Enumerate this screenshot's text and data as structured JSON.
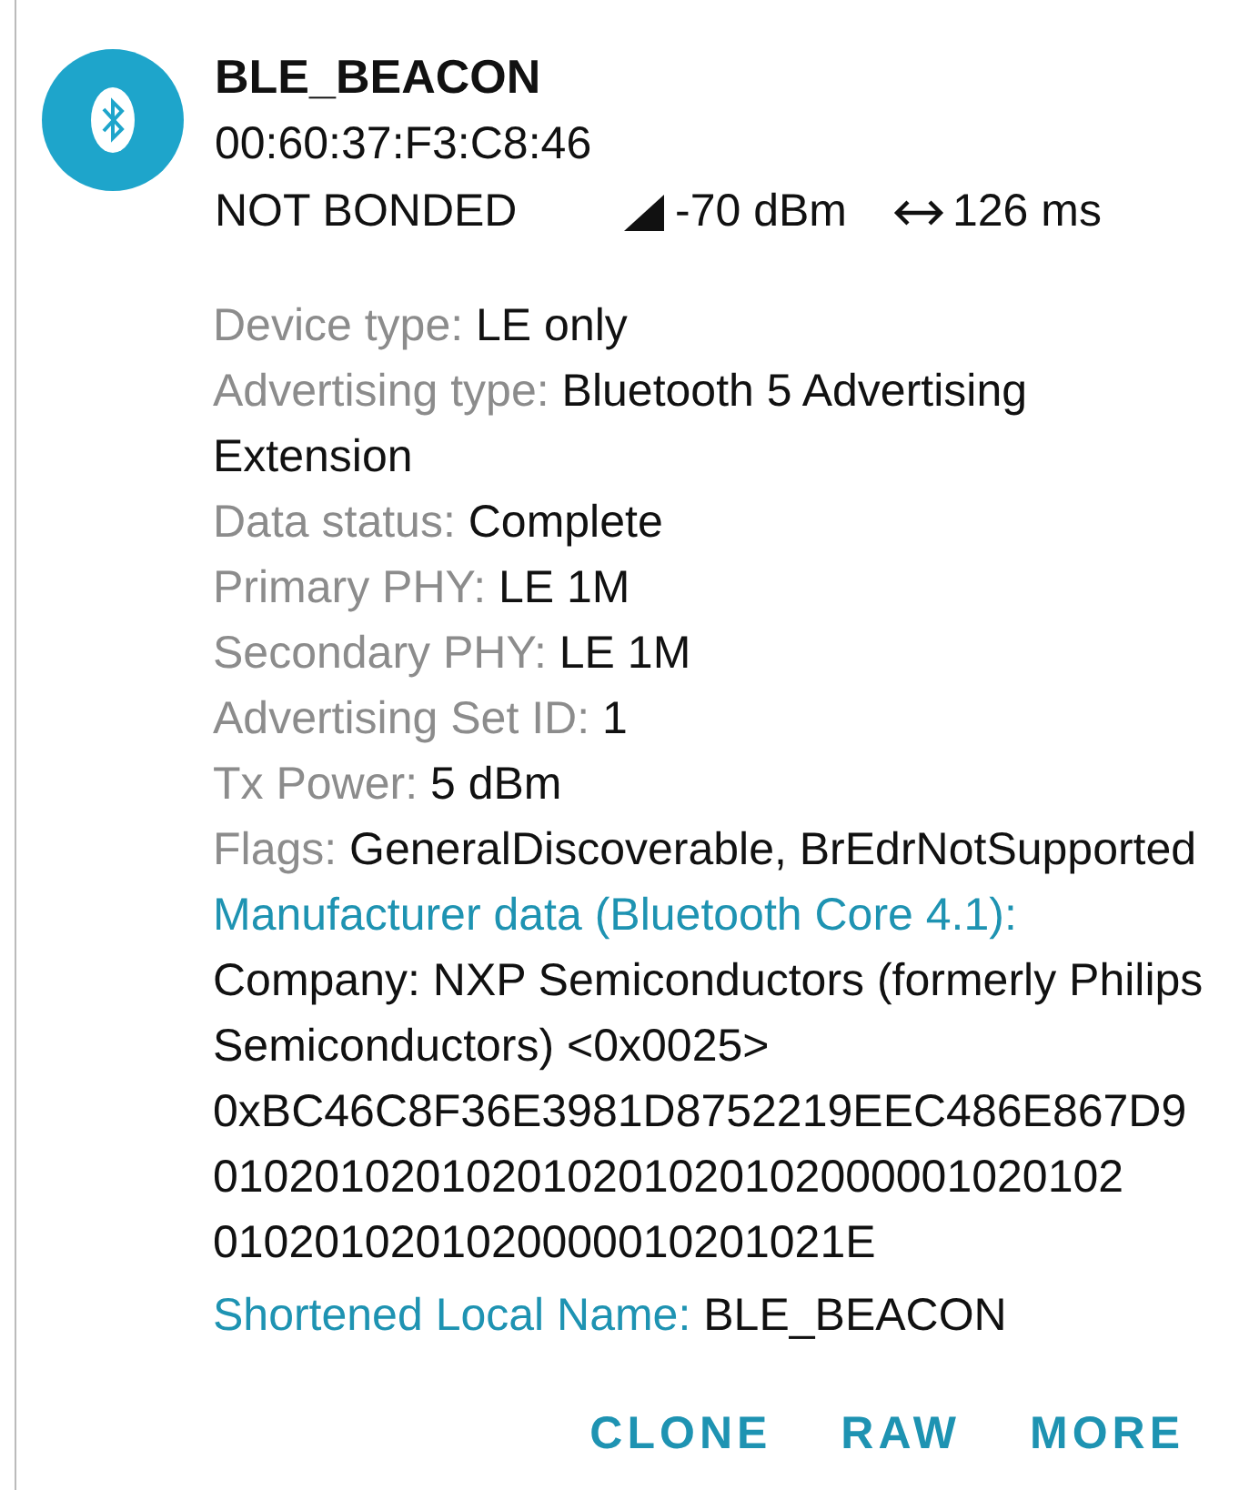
{
  "device": {
    "name": "BLE_BEACON",
    "address": "00:60:37:F3:C8:46",
    "bond_state": "NOT BONDED",
    "rssi": "-70 dBm",
    "interval": "126 ms"
  },
  "details": [
    {
      "kind": "property",
      "label": "Device type:",
      "value": "LE only"
    },
    {
      "kind": "property",
      "label": "Advertising type:",
      "value": "Bluetooth 5 Advertising Extension"
    },
    {
      "kind": "property",
      "label": "Data status:",
      "value": "Complete"
    },
    {
      "kind": "property",
      "label": "Primary PHY:",
      "value": "LE 1M"
    },
    {
      "kind": "property",
      "label": "Secondary PHY:",
      "value": "LE 1M"
    },
    {
      "kind": "property",
      "label": "Advertising Set ID:",
      "value": "1"
    },
    {
      "kind": "property",
      "label": "Tx Power:",
      "value": "5 dBm"
    },
    {
      "kind": "property",
      "label": "Flags:",
      "value": "GeneralDiscoverable, BrEdrNotSupported"
    },
    {
      "kind": "section",
      "label": "Manufacturer data (Bluetooth Core 4.1):",
      "lines": [
        "Company: NXP Semiconductors (formerly Philips Semiconductors) <0x0025>",
        "0xBC46C8F36E3981D8752219EEC486E867D9",
        "010201020102010201020102000001020102",
        "0102010201020000010201021E"
      ]
    },
    {
      "kind": "inline_section",
      "label": "Shortened Local Name:",
      "value": "BLE_BEACON"
    }
  ],
  "actions": [
    "CLONE",
    "RAW",
    "MORE"
  ]
}
